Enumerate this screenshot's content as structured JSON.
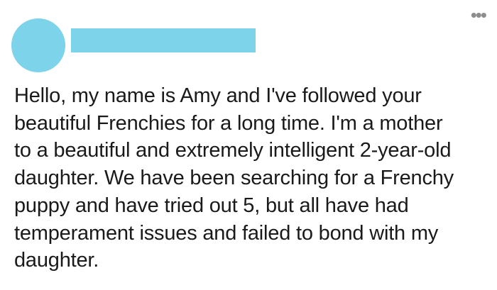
{
  "post": {
    "author_avatar_color": "#7dd3ea",
    "author_name_redaction_color": "#7dd3ea",
    "menu_label": "•••",
    "lines": [
      "Hello, my name is Amy and I've followed your",
      "beautiful Frenchies for a long time. I'm a mother",
      "to a beautiful and extremely intelligent 2-year-old",
      "daughter. We have been searching for a Frenchy",
      "puppy and have tried out 5, but all have had",
      "temperament issues and failed to bond with my",
      "daughter."
    ]
  }
}
